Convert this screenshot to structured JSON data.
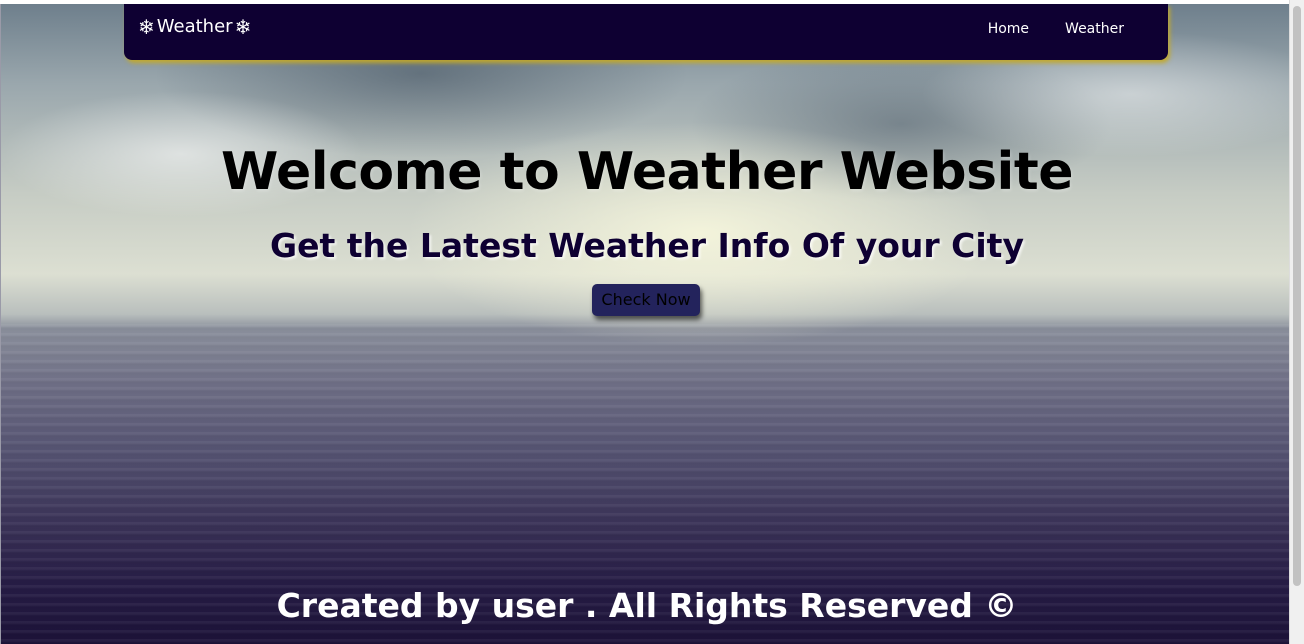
{
  "navbar": {
    "brand": {
      "icon_left": "❄",
      "text": "Weather",
      "icon_right": "❄",
      "icon_name": "snowflake-icon"
    },
    "links": [
      {
        "label": "Home"
      },
      {
        "label": "Weather"
      }
    ]
  },
  "hero": {
    "title": "Welcome to Weather Website",
    "subtitle": "Get the Latest Weather Info Of your City",
    "cta_label": "Check Now"
  },
  "footer": {
    "text": "Created by user . All Rights Reserved ©"
  },
  "colors": {
    "navbar_bg": "#0e0032",
    "navbar_shadow": "#c4aa28",
    "subtitle": "#0e0032",
    "button_bg": "#23235c"
  }
}
